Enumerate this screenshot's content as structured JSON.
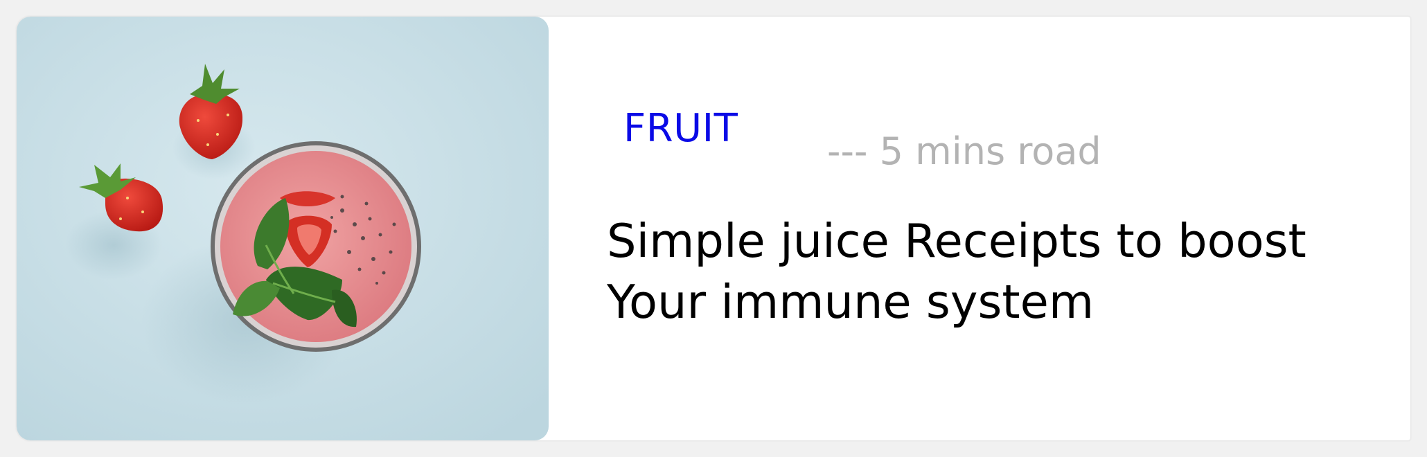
{
  "article": {
    "category": "FRUIT",
    "read_time": "--- 5 mins road",
    "title": "Simple juice Receipts to boost Your immune system"
  },
  "image": {
    "subject": "strawberry smoothie with mint and chia seeds, two strawberries on light blue background"
  },
  "colors": {
    "category": "#0a0ae6",
    "read_time": "#b3b3b3",
    "title": "#000000",
    "photo_background": "#cfe3ea",
    "smoothie": "#e8888e",
    "strawberry": "#d9261c",
    "mint": "#3f7a2e"
  }
}
